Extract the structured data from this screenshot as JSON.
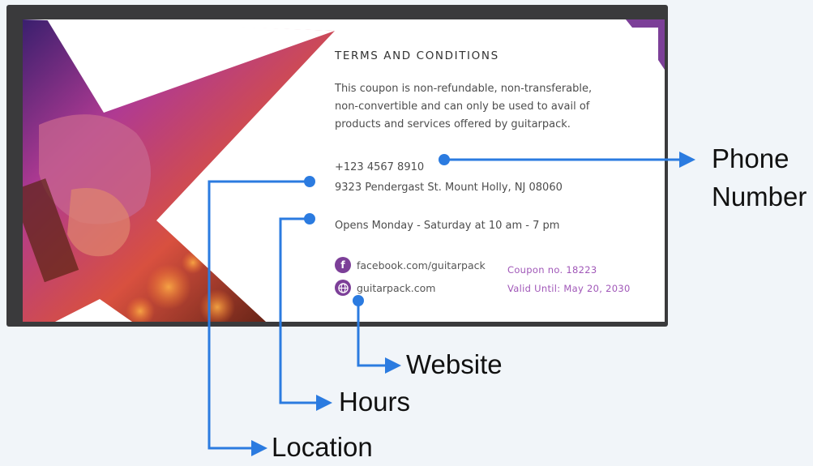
{
  "coupon": {
    "title": "TERMS AND CONDITIONS",
    "terms_lines": [
      "This coupon is non-refundable, non-transferable,",
      "non-convertible and can only be used to avail of",
      "products and services offered by guitarpack."
    ],
    "phone": "+123 4567 8910",
    "address": "9323 Pendergast St.  Mount Holly, NJ 08060",
    "hours": "Opens Monday - Saturday at 10 am - 7 pm",
    "facebook": "facebook.com/guitarpack",
    "website": "guitarpack.com",
    "coupon_no": "Coupon no. 18223",
    "valid_until": "Valid Until: May 20, 2030"
  },
  "callouts": {
    "phone_line1": "Phone",
    "phone_line2": "Number",
    "website": "Website",
    "hours": "Hours",
    "location": "Location"
  },
  "colors": {
    "arrow": "#2b7be0",
    "frame": "#3a3a3c",
    "accent_purple": "#7c3f98",
    "coupon_text": "#a057b8"
  },
  "icons": [
    "facebook-icon",
    "globe-icon"
  ]
}
